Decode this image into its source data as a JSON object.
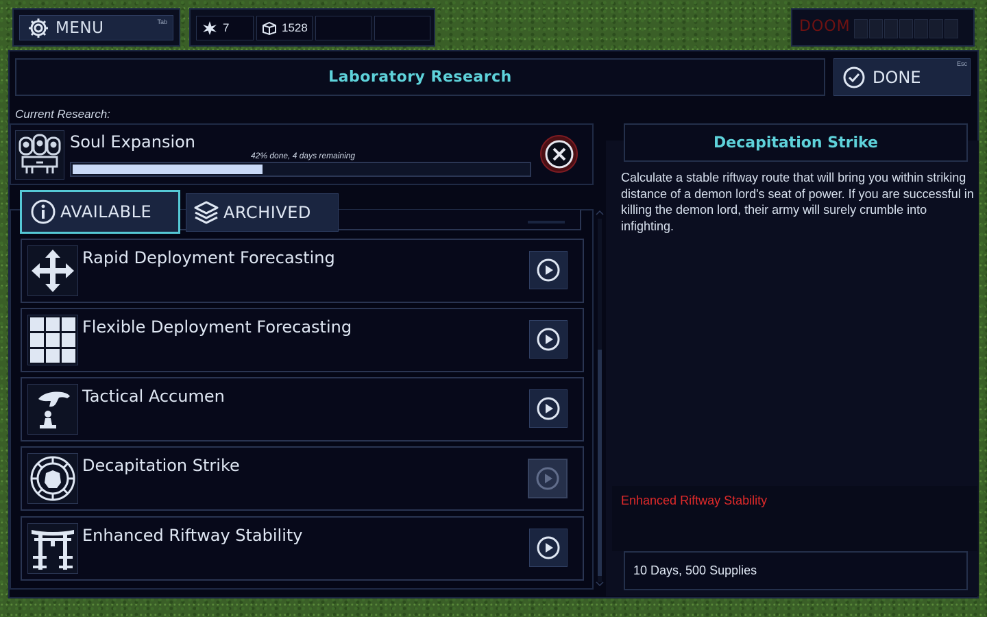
{
  "top_bar": {
    "menu_label": "MENU",
    "menu_hotkey": "Tab",
    "resources": [
      {
        "icon": "star-burst-icon",
        "value": "7"
      },
      {
        "icon": "supplies-crate-icon",
        "value": "1528"
      }
    ],
    "doom_label": "DOOM",
    "doom_level": 0
  },
  "header": {
    "title": "Laboratory Research",
    "done_label": "DONE",
    "done_hotkey": "Esc"
  },
  "current_research": {
    "label": "Current Research:",
    "name": "Soul Expansion",
    "icon": "skull-faces-icon",
    "progress_text": "42% done, 4 days remaining",
    "progress_fraction": 0.42
  },
  "tabs": [
    {
      "label": "AVAILABLE",
      "icon": "info-icon",
      "active": true
    },
    {
      "label": "ARCHIVED",
      "icon": "layers-icon",
      "active": false
    }
  ],
  "research_items": [
    {
      "name": "Rapid Deployment Forecasting",
      "icon": "move-arrows-icon",
      "startable": true
    },
    {
      "name": "Flexible Deployment Forecasting",
      "icon": "grid-icon",
      "startable": true
    },
    {
      "name": "Tactical Accumen",
      "icon": "hand-chess-piece-icon",
      "startable": true
    },
    {
      "name": "Decapitation Strike",
      "icon": "crosshair-target-icon",
      "startable": false
    },
    {
      "name": "Enhanced Riftway Stability",
      "icon": "torii-gate-icon",
      "startable": true
    }
  ],
  "detail": {
    "title": "Decapitation Strike",
    "description": "Calculate a stable riftway route that will bring you within striking distance of a demon lord's seat of power.  If you are successful in killing the demon lord, their army will surely crumble into infighting.",
    "prerequisite": "Enhanced Riftway Stability",
    "cost": "10 Days, 500 Supplies"
  },
  "colors": {
    "accent_cyan": "#5ed2da",
    "warning_red": "#e02a2a",
    "panel_bg": "#07091a",
    "button_bg": "#1a2540"
  }
}
